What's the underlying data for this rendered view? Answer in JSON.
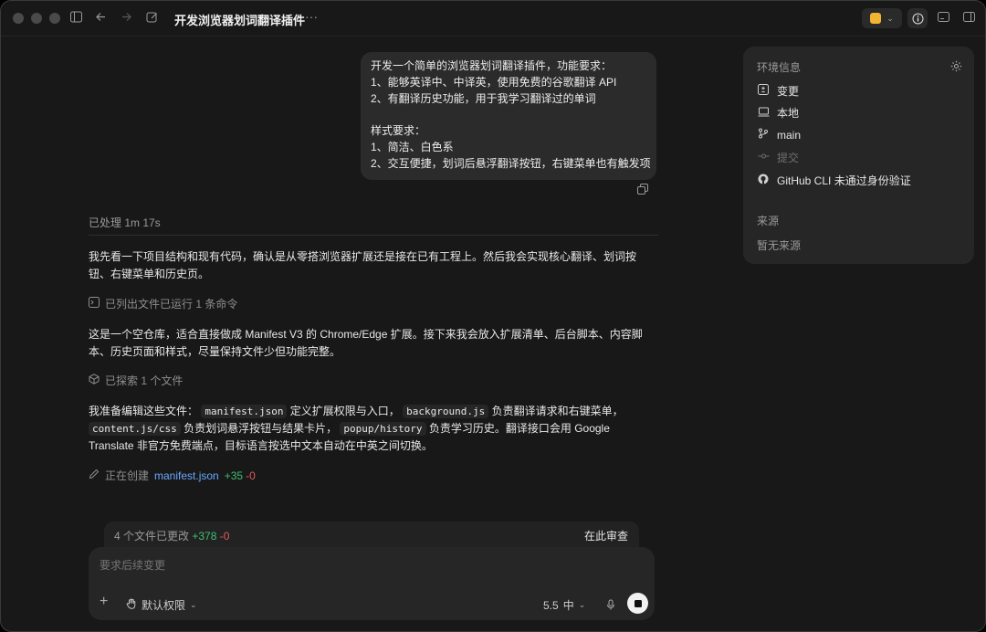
{
  "window": {
    "title": "开发浏览器划词翻译插件"
  },
  "user_message": {
    "lines": [
      "开发一个简单的浏览器划词翻译插件，功能要求：",
      "1、能够英译中、中译英，使用免费的谷歌翻译 API",
      "2、有翻译历史功能，用于我学习翻译过的单词",
      "",
      "样式要求：",
      "1、简洁、白色系",
      "2、交互便捷，划词后悬浮翻译按钮，右键菜单也有触发项"
    ]
  },
  "processed": "已处理 1m 17s",
  "paragraphs": {
    "p1": "我先看一下项目结构和现有代码，确认是从零搭浏览器扩展还是接在已有工程上。然后我会实现核心翻译、划词按钮、右键菜单和历史页。",
    "p2": "这是一个空仓库，适合直接做成 Manifest V3 的 Chrome/Edge 扩展。接下来我会放入扩展清单、后台脚本、内容脚本、历史页面和样式，尽量保持文件少但功能完整。",
    "p3": {
      "a": "我准备编辑这些文件：",
      "code1": "manifest.json",
      "b": "定义扩展权限与入口，",
      "code2": "background.js",
      "c": "负责翻译请求和右键菜单，",
      "code3": "content.js/css",
      "d": "负责划词悬浮按钮与结果卡片，",
      "code4": "popup/history",
      "e": "负责学习历史。翻译接口会用 Google Translate 非官方免费端点，目标语言按选中文本自动在中英之间切换。"
    }
  },
  "steps": {
    "listed": "已列出文件已运行 1 条命令",
    "explored": "已探索 1 个文件",
    "creating_label": "正在创建",
    "creating_file": "manifest.json",
    "creating_add": "+35",
    "creating_del": "-0"
  },
  "files_bar": {
    "label": "4 个文件已更改",
    "add": "+378",
    "del": "-0",
    "review": "在此审查"
  },
  "composer": {
    "placeholder": "要求后续变更",
    "permission": "默认权限",
    "model": "5.5",
    "effort": "中"
  },
  "env_panel": {
    "title": "环境信息",
    "items": {
      "changes": "变更",
      "local": "本地",
      "branch": "main",
      "commit": "提交",
      "github": "GitHub CLI 未通过身份验证"
    },
    "source_title": "来源",
    "source_empty": "暂无来源"
  },
  "colors": {
    "background": "#181818",
    "bubble": "#2b2b2b",
    "panel": "#262626",
    "add_green": "#3fbf72",
    "del_red": "#e25b5b",
    "link_blue": "#6aa8ff"
  },
  "icons": [
    "sidebar-icon",
    "back-arrow-icon",
    "forward-arrow-icon",
    "edit-icon",
    "more-icon",
    "terminal-icon",
    "cube-icon",
    "pencil-icon",
    "plus-icon",
    "hand-icon",
    "mic-icon",
    "stop-icon",
    "gear-icon",
    "diff-icon",
    "laptop-icon",
    "branch-icon",
    "commit-icon",
    "github-icon",
    "info-icon",
    "panel-icon",
    "copy-icon",
    "chevron-down-icon"
  ]
}
